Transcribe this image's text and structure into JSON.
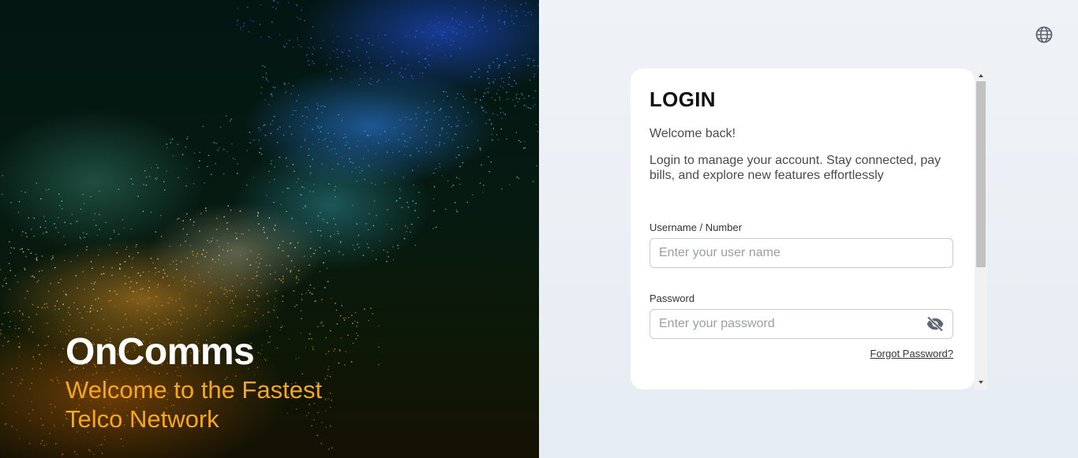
{
  "hero": {
    "brand": "OnComms",
    "tagline": "Welcome to the Fastest Telco Network"
  },
  "header": {
    "language_icon": "globe-icon"
  },
  "login": {
    "title": "LOGIN",
    "welcome": "Welcome back!",
    "description": "Login to manage your account. Stay connected, pay bills, and explore new features effortlessly",
    "username": {
      "label": "Username / Number",
      "placeholder": "Enter your user name",
      "value": ""
    },
    "password": {
      "label": "Password",
      "placeholder": "Enter your password",
      "value": "",
      "toggle_icon": "eye-off-icon"
    },
    "forgot_password": "Forgot Password?"
  },
  "colors": {
    "brand_accent": "#f5a623",
    "hero_dark": "#061a12",
    "panel_bg": "#eff3f7",
    "card_bg": "#ffffff"
  }
}
